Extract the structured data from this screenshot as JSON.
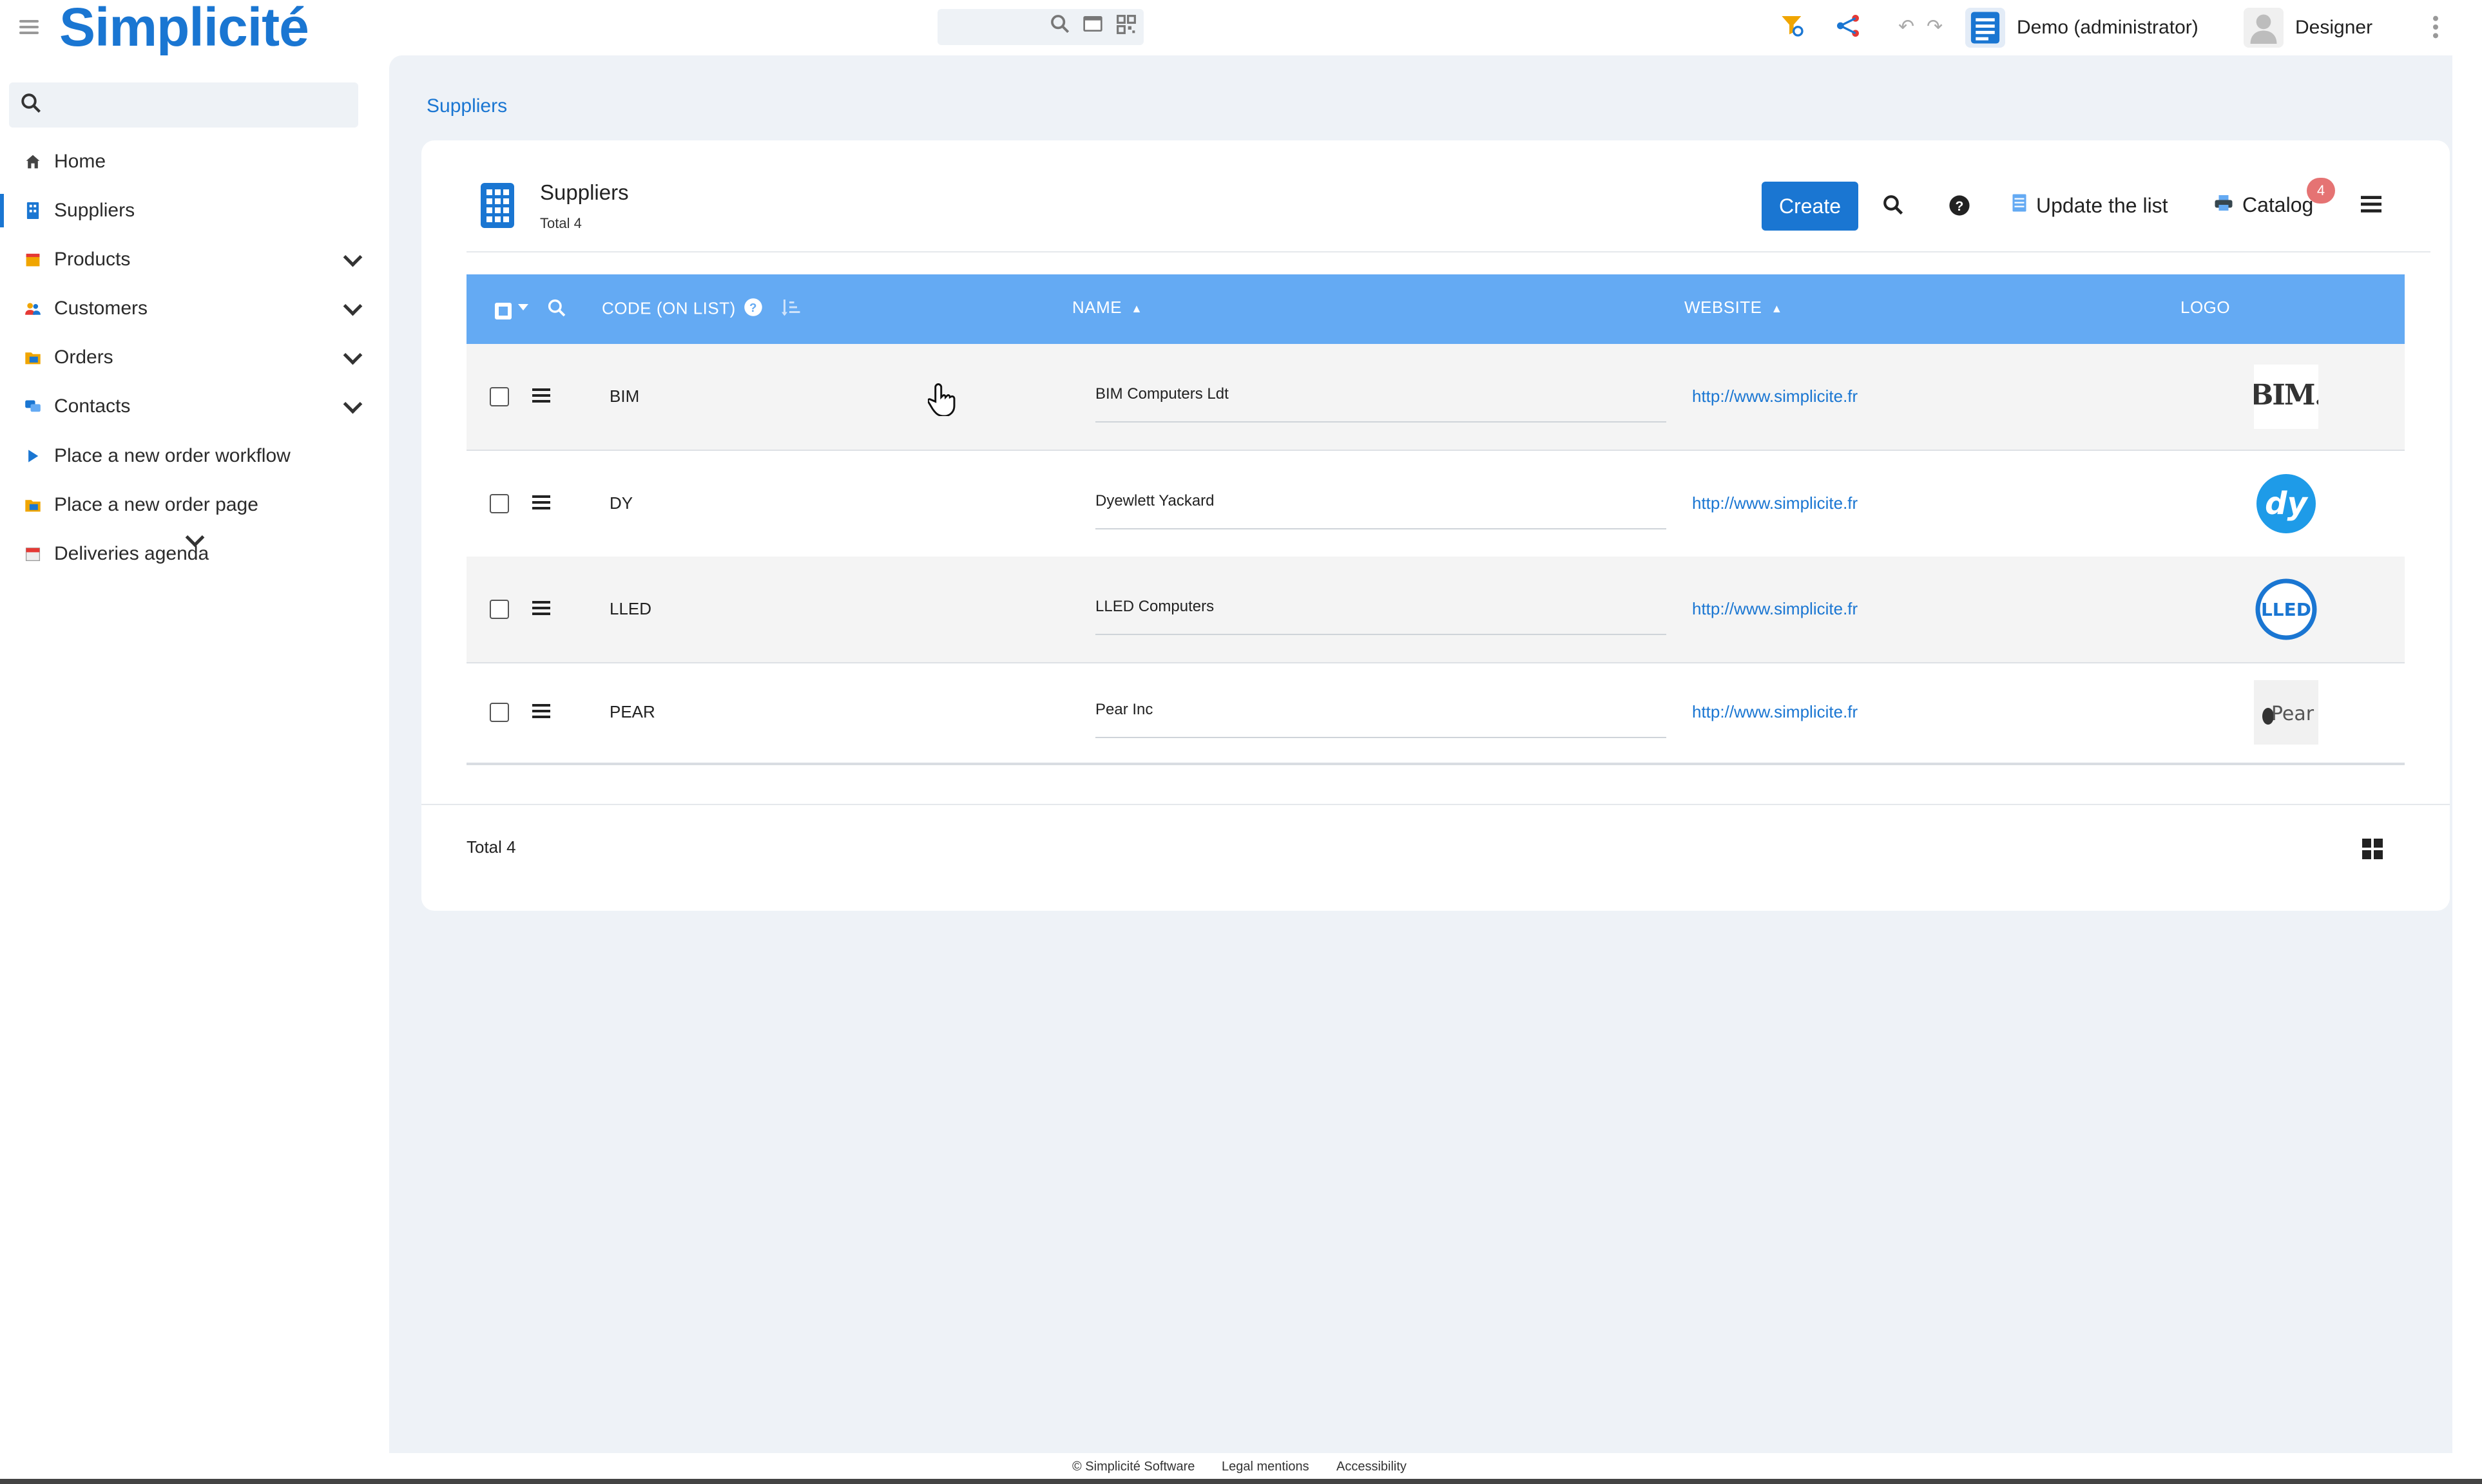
{
  "header": {
    "app_name": "Simplicité",
    "user_scope": "Demo (administrator)",
    "user_name": "Designer"
  },
  "sidebar": {
    "search_placeholder": "",
    "items": [
      {
        "label": "Home",
        "icon": "home-icon",
        "expandable": false,
        "active": false
      },
      {
        "label": "Suppliers",
        "icon": "building-icon",
        "expandable": false,
        "active": true
      },
      {
        "label": "Products",
        "icon": "box-icon",
        "expandable": true,
        "active": false
      },
      {
        "label": "Customers",
        "icon": "users-icon",
        "expandable": true,
        "active": false
      },
      {
        "label": "Orders",
        "icon": "folder-icon",
        "expandable": true,
        "active": false
      },
      {
        "label": "Contacts",
        "icon": "chat-icon",
        "expandable": true,
        "active": false
      },
      {
        "label": "Place a new order workflow",
        "icon": "play-icon",
        "expandable": false,
        "active": false
      },
      {
        "label": "Place a new order page",
        "icon": "folder-icon",
        "expandable": false,
        "active": false
      },
      {
        "label": "Deliveries agenda",
        "icon": "calendar-icon",
        "expandable": false,
        "active": false
      }
    ]
  },
  "breadcrumb": "Suppliers",
  "list": {
    "title": "Suppliers",
    "subtitle": "Total 4",
    "create_label": "Create",
    "update_label": "Update the list",
    "catalog_label": "Catalog",
    "catalog_badge": "4",
    "columns": {
      "code": "CODE (ON LIST)",
      "name": "NAME",
      "website": "WEBSITE",
      "logo": "LOGO"
    },
    "rows": [
      {
        "code": "BIM",
        "name": "BIM Computers Ldt",
        "website": "http://www.simplicite.fr",
        "logo": "BIM."
      },
      {
        "code": "DY",
        "name": "Dyewlett Yackard",
        "website": "http://www.simplicite.fr",
        "logo": "dy"
      },
      {
        "code": "LLED",
        "name": "LLED Computers",
        "website": "http://www.simplicite.fr",
        "logo": "LLED"
      },
      {
        "code": "PEAR",
        "name": "Pear Inc",
        "website": "http://www.simplicite.fr",
        "logo": "Pear"
      }
    ],
    "footer_total": "Total 4"
  },
  "footer": {
    "copyright": "© Simplicité Software",
    "legal": "Legal mentions",
    "accessibility": "Accessibility"
  },
  "colors": {
    "accent": "#1a76d2",
    "table_header": "#64aaf3",
    "badge": "#e57373",
    "background": "#eef2f7"
  }
}
